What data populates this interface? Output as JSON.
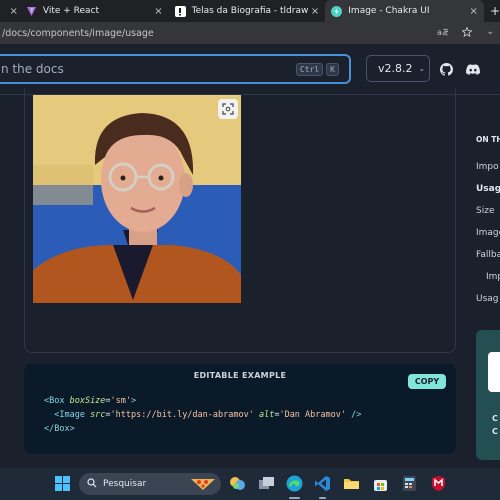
{
  "browser": {
    "tabs": [
      {
        "title": "",
        "close": "×"
      },
      {
        "title": "Vite + React",
        "close": "×"
      },
      {
        "title": "Telas da Biografia - tldraw",
        "close": "×"
      },
      {
        "title": "Image - Chakra UI",
        "close": "×"
      }
    ],
    "url": "/docs/components/image/usage",
    "new_tab": "+",
    "menu": "⌄"
  },
  "header": {
    "search_placeholder": "n the docs",
    "kbd_ctrl": "Ctrl",
    "kbd_k": "K",
    "version": "v2.8.2"
  },
  "example": {
    "image_alt": "Dan Abramov"
  },
  "code_block": {
    "title": "EDITABLE EXAMPLE",
    "copy_label": "COPY",
    "line1_open": "<Box ",
    "line1_attr": "boxSize",
    "line1_eq": "=",
    "line1_val": "'sm'",
    "line1_close": ">",
    "line2_open": "  <Image ",
    "line2_attr1": "src",
    "line2_eq1": "=",
    "line2_val1": "'https://bit.ly/dan-abramov'",
    "line2_attr2": " alt",
    "line2_eq2": "=",
    "line2_val2": "'Dan Abramov'",
    "line2_close": " />",
    "line3": "</Box>"
  },
  "toc": {
    "heading": "ON TH",
    "items": [
      "Impo",
      "Usag",
      "Size",
      "Image",
      "Fallba",
      "Imp",
      "Usag"
    ]
  },
  "promo": {
    "line1": "C",
    "line2": "C"
  },
  "taskbar": {
    "search_label": "Pesquisar"
  },
  "colors": {
    "page_bg": "#1a202c",
    "accent_teal": "#81e6d9",
    "search_border": "#4a90d9",
    "promo_bg": "#234e52"
  }
}
